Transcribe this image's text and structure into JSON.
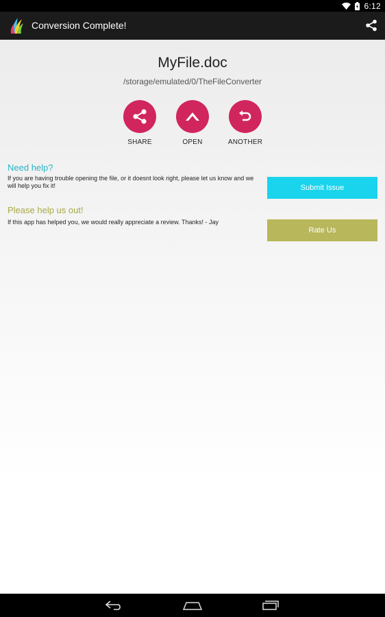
{
  "status_bar": {
    "time": "6:12",
    "icons": [
      "wifi-icon",
      "battery-icon"
    ]
  },
  "action_bar": {
    "title": "Conversion Complete!",
    "icons": [
      "app-logo-icon",
      "share-icon"
    ]
  },
  "file": {
    "name": "MyFile.doc",
    "path": "/storage/emulated/0/TheFileConverter"
  },
  "actions": [
    {
      "label": "SHARE",
      "icon": "share-icon"
    },
    {
      "label": "OPEN",
      "icon": "chevron-up-icon"
    },
    {
      "label": "ANOTHER",
      "icon": "undo-icon"
    }
  ],
  "help": {
    "title": "Need help?",
    "text": "If you are having trouble opening the file, or it doesnt look right, please let us know and we will help you fix it!",
    "button": "Submit Issue",
    "title_color": "#27b3c7",
    "button_color": "#19d4ec"
  },
  "review": {
    "title": "Please help us out!",
    "text": "If this app has helped you, we would really appreciate a review. Thanks! - Jay",
    "button": "Rate Us",
    "title_color": "#a8aa47",
    "button_color": "#b8b75c"
  },
  "colors": {
    "accent": "#d1255d",
    "action_bar": "#1b1b1b"
  },
  "nav_bar": {
    "icons": [
      "back-icon",
      "home-icon",
      "recents-icon"
    ]
  }
}
